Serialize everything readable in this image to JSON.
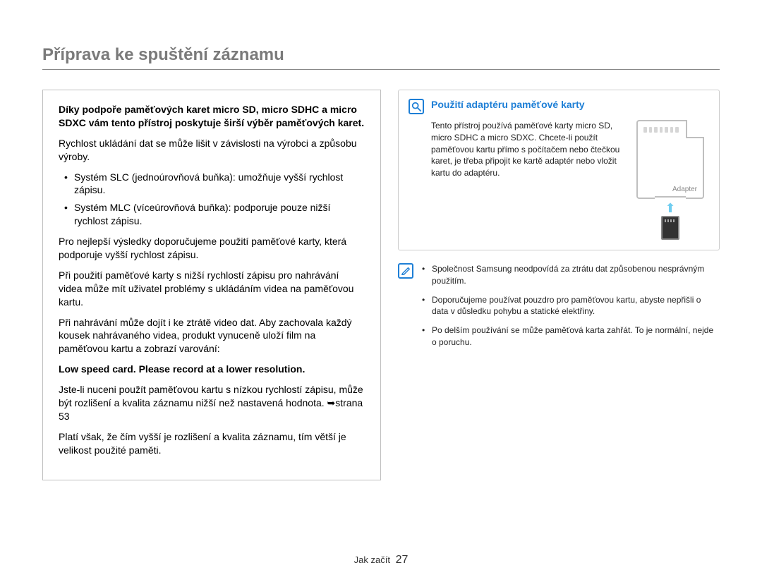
{
  "title": "Příprava ke spuštění záznamu",
  "left": {
    "intro_bold": "Díky podpoře paměťových karet micro SD, micro SDHC a micro SDXC vám tento přístroj poskytuje širší výběr paměťových karet.",
    "p1": "Rychlost ukládání dat se může lišit v závislosti na výrobci a způsobu výroby.",
    "bullets": [
      "Systém SLC (jednoúrovňová buňka): umožňuje vyšší rychlost zápisu.",
      "Systém MLC (víceúrovňová buňka): podporuje pouze nižší rychlost zápisu."
    ],
    "p2": "Pro nejlepší výsledky doporučujeme použití paměťové karty, která podporuje vyšší rychlost zápisu.",
    "p3": "Při použití paměťové karty s nižší rychlostí zápisu pro nahrávání videa může mít uživatel problémy s ukládáním videa na paměťovou kartu.",
    "p4": "Při nahrávání může dojít i ke ztrátě video dat. Aby zachovala každý kousek nahrávaného videa, produkt vynuceně uloží film na paměťovou kartu a zobrazí varování:",
    "warning": "Low speed card. Please record at a lower resolution.",
    "p5": "Jste-li nuceni použít paměťovou kartu s nízkou rychlostí zápisu, může být rozlišení a kvalita záznamu nižší než nastavená hodnota. ➥strana 53",
    "p6": "Platí však, že čím vyšší je rozlišení a kvalita záznamu, tím větší je velikost použité paměti."
  },
  "right": {
    "adapter_title": "Použití adaptéru paměťové karty",
    "adapter_text": "Tento přístroj používá paměťové karty micro SD, micro SDHC a micro SDXC.\nChcete-li použít paměťovou kartu přímo s počítačem nebo čtečkou karet, je třeba připojit ke kartě adaptér nebo vložit kartu do adaptéru.",
    "adapter_label": "Adapter",
    "notes": [
      "Společnost Samsung neodpovídá za ztrátu dat způsobenou nesprávným použitím.",
      "Doporučujeme používat pouzdro pro paměťovou kartu, abyste nepřišli o data v důsledku pohybu a statické elektřiny.",
      "Po delším používání se může paměťová karta zahřát. To je normální, nejde o poruchu."
    ]
  },
  "footer": {
    "section": "Jak začít",
    "page": "27"
  }
}
